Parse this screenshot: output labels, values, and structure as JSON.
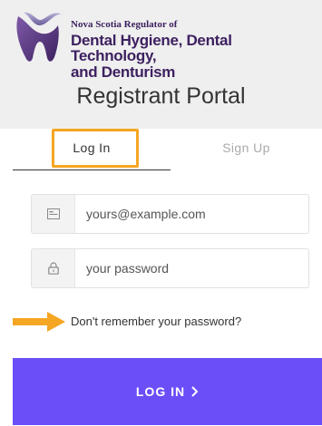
{
  "header": {
    "org_line1": "Nova Scotia Regulator of",
    "org_line2": "Dental Hygiene, Dental Technology,",
    "org_line3": "and Denturism",
    "portal_title": "Registrant Portal"
  },
  "tabs": [
    {
      "label": "Log In",
      "active": true
    },
    {
      "label": "Sign Up",
      "active": false
    }
  ],
  "form": {
    "email_placeholder": "yours@example.com",
    "email_value": "",
    "email_icon": "envelope-icon",
    "password_placeholder": "your password",
    "password_value": "",
    "password_icon": "lock-icon",
    "forgot_link": "Don't remember your password?",
    "submit_label": "LOG IN",
    "submit_icon": "chevron-right-icon"
  },
  "colors": {
    "brand_purple": "#3d2160",
    "button": "#6b4ef7",
    "annotation": "#f5a623",
    "header_bg": "#efefef"
  }
}
